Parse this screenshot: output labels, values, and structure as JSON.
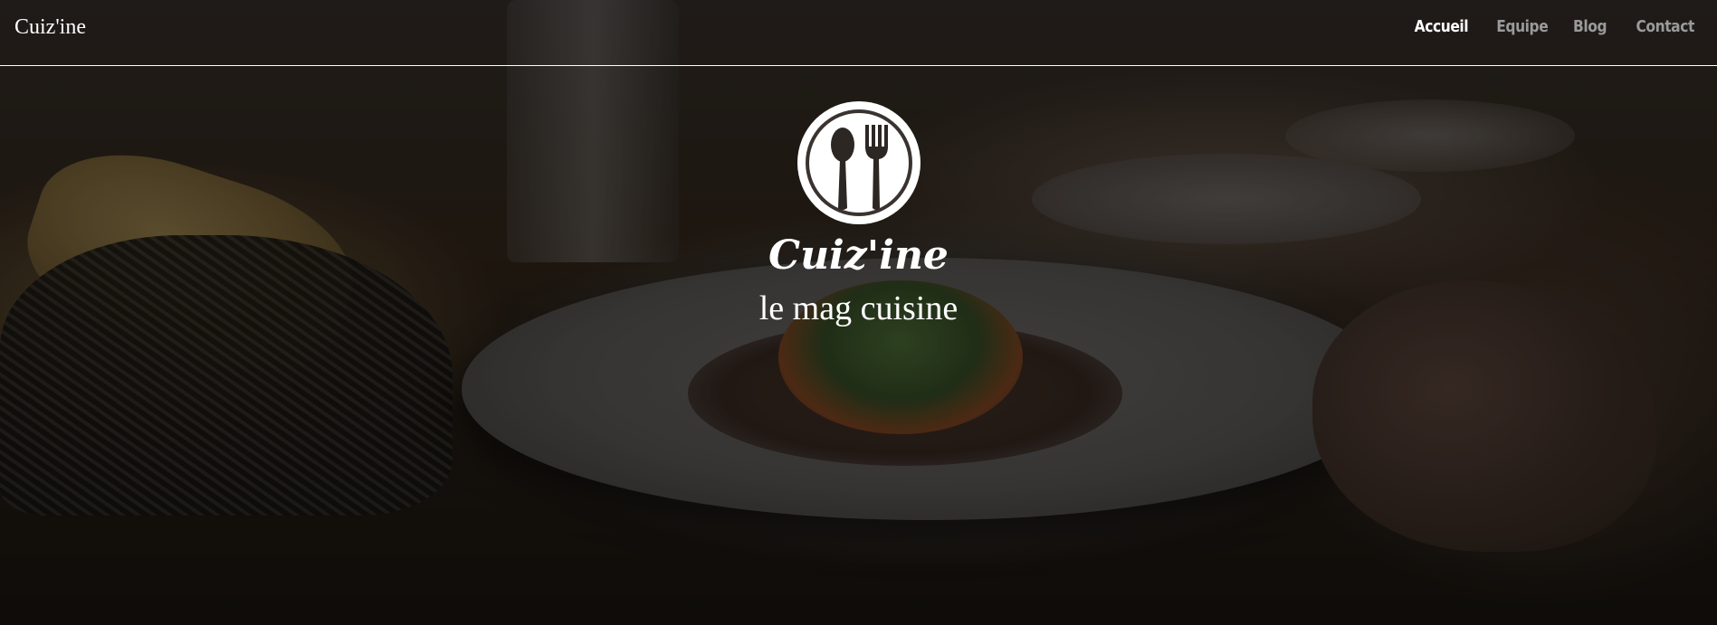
{
  "header": {
    "brand": "Cuiz'ine",
    "nav": [
      {
        "label": "Accueil",
        "active": true
      },
      {
        "label": "Equipe",
        "active": false
      },
      {
        "label": "Blog",
        "active": false
      },
      {
        "label": "Contact",
        "active": false
      }
    ]
  },
  "hero": {
    "logo_icon": "spoon-fork-icon",
    "title": "Cuiz'ine",
    "subtitle": "le mag cuisine",
    "background": "dark restaurant table photo with plated dish, bread basket and hand"
  },
  "colors": {
    "text": "#ffffff",
    "nav_inactive": "#9a9a9a",
    "divider": "#ffffff"
  }
}
